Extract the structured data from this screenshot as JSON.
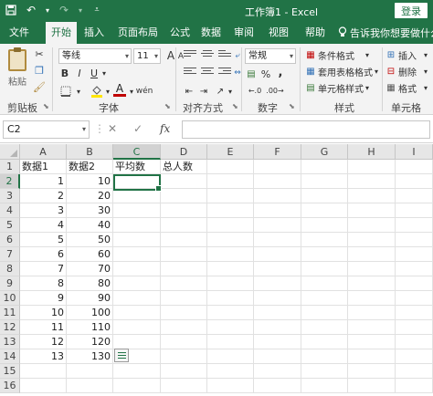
{
  "titlebar": {
    "title": "工作簿1 - Excel",
    "login_label": "登录"
  },
  "menu": {
    "tabs": [
      "文件",
      "开始",
      "插入",
      "页面布局",
      "公式",
      "数据",
      "审阅",
      "视图",
      "帮助"
    ],
    "active": "开始",
    "tellme": "告诉我你想要做什么"
  },
  "ribbon": {
    "clipboard": {
      "paste": "粘贴",
      "label": "剪贴板"
    },
    "font": {
      "name": "等线",
      "size": "11",
      "label": "字体",
      "bold": "B",
      "italic": "I",
      "underline": "U",
      "font_color_glyph": "A",
      "grow_glyph": "A",
      "shrink_glyph": "A",
      "phonetic_glyph": "wén"
    },
    "alignment": {
      "label": "对齐方式"
    },
    "number": {
      "format": "常规",
      "label": "数字",
      "percent": "%",
      "comma": ","
    },
    "styles": {
      "conditional": "条件格式",
      "table": "套用表格格式",
      "cell": "单元格样式",
      "label": "样式"
    },
    "cells": {
      "insert": "插入",
      "delete": "删除",
      "format": "格式",
      "label": "单元格"
    },
    "accent": "#217346"
  },
  "formula_bar": {
    "name_box": "C2",
    "cancel": "✕",
    "enter": "✓",
    "fx": "fx",
    "value": ""
  },
  "sheet": {
    "columns": [
      "A",
      "B",
      "C",
      "D",
      "E",
      "F",
      "G",
      "H",
      "I"
    ],
    "rows": [
      "1",
      "2",
      "3",
      "4",
      "5",
      "6",
      "7",
      "8",
      "9",
      "10",
      "11",
      "12",
      "13",
      "14",
      "15",
      "16"
    ],
    "selected_column": "C",
    "selected_row": "2",
    "headers": [
      "数据1",
      "数据2",
      "平均数",
      "总人数"
    ],
    "colA": [
      "1",
      "2",
      "3",
      "4",
      "5",
      "6",
      "7",
      "8",
      "9",
      "10",
      "11",
      "12",
      "13"
    ],
    "colB": [
      "10",
      "20",
      "30",
      "40",
      "50",
      "60",
      "70",
      "80",
      "90",
      "100",
      "110",
      "120",
      "130"
    ]
  }
}
